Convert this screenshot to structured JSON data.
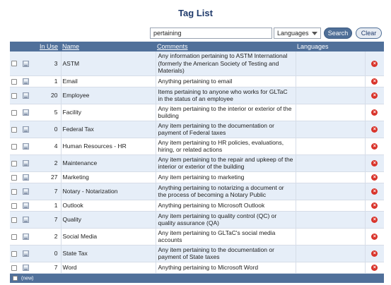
{
  "title": "Tag List",
  "search": {
    "value": "pertaining",
    "language_selected": "Languages",
    "search_label": "Search",
    "clear_label": "Clear"
  },
  "columns": {
    "in_use": "In Use",
    "name": "Name",
    "comments": "Comments",
    "languages": "Languages"
  },
  "rows": [
    {
      "in_use": "3",
      "name": "ASTM",
      "comment": "Any information pertaining to ASTM International (formerly the American Society of Testing and Materials)"
    },
    {
      "in_use": "1",
      "name": "Email",
      "comment": "Anything pertaining to email"
    },
    {
      "in_use": "20",
      "name": "Employee",
      "comment": "Items pertaining to anyone who works for GLTaC in the status of an employee"
    },
    {
      "in_use": "5",
      "name": "Facility",
      "comment": "Any item pertaining to the interior or exterior of the building"
    },
    {
      "in_use": "0",
      "name": "Federal Tax",
      "comment": "Any item pertaining to the documentation or payment of Federal taxes"
    },
    {
      "in_use": "4",
      "name": "Human Resources - HR",
      "comment": "Any item pertaining to HR policies, evaluations, hiring, or related actions"
    },
    {
      "in_use": "2",
      "name": "Maintenance",
      "comment": "Any item pertaining to the repair and upkeep of the interior or exterior of the building"
    },
    {
      "in_use": "27",
      "name": "Marketing",
      "comment": "Any item pertaining to marketing"
    },
    {
      "in_use": "7",
      "name": "Notary - Notarization",
      "comment": "Anything pertaining to notarizing a document or the process of becoming a Notary Public"
    },
    {
      "in_use": "1",
      "name": "Outlook",
      "comment": "Anything pertaining to Microsoft Outlook"
    },
    {
      "in_use": "7",
      "name": "Quality",
      "comment": "Any item pertaining to quality control (QC) or quality assurance (QA)"
    },
    {
      "in_use": "2",
      "name": "Social Media",
      "comment": "Any item pertaining to GLTaC's social media accounts"
    },
    {
      "in_use": "0",
      "name": "State Tax",
      "comment": "Any item pertaining to the documentation or payment of State taxes"
    },
    {
      "in_use": "7",
      "name": "Word",
      "comment": "Anything pertaining to Microsoft Word"
    }
  ],
  "footer": {
    "new_label": "(new)"
  },
  "icons": {
    "row_checkbox": "checkbox",
    "save": "save-icon",
    "delete": "delete-icon"
  },
  "colors": {
    "header": "#50709a",
    "row_alt": "#e6eef8",
    "title": "#1f3a6b",
    "delete": "#d9342b"
  }
}
